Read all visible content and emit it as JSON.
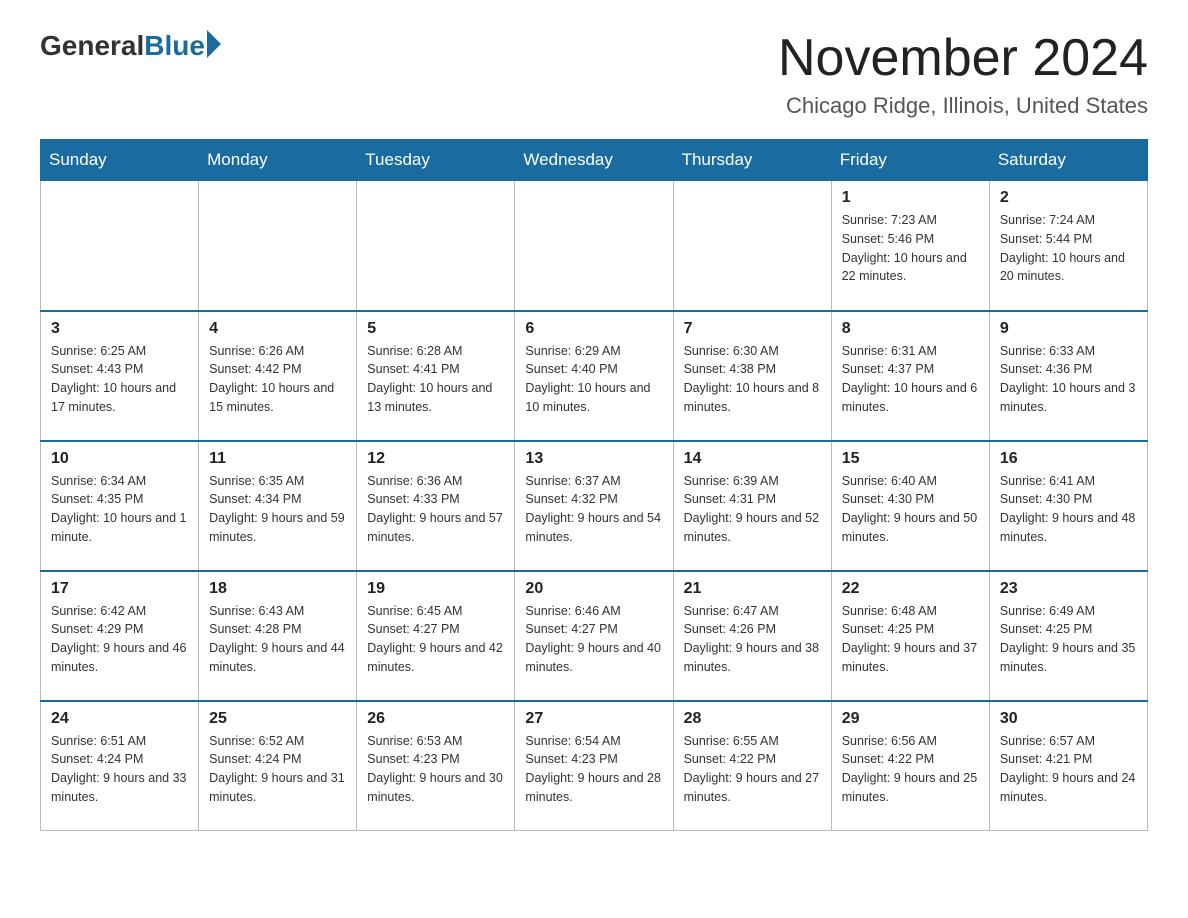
{
  "header": {
    "logo_general": "General",
    "logo_blue": "Blue",
    "month_title": "November 2024",
    "location": "Chicago Ridge, Illinois, United States"
  },
  "days_of_week": [
    "Sunday",
    "Monday",
    "Tuesday",
    "Wednesday",
    "Thursday",
    "Friday",
    "Saturday"
  ],
  "weeks": [
    [
      {
        "day": "",
        "sunrise": "",
        "sunset": "",
        "daylight": ""
      },
      {
        "day": "",
        "sunrise": "",
        "sunset": "",
        "daylight": ""
      },
      {
        "day": "",
        "sunrise": "",
        "sunset": "",
        "daylight": ""
      },
      {
        "day": "",
        "sunrise": "",
        "sunset": "",
        "daylight": ""
      },
      {
        "day": "",
        "sunrise": "",
        "sunset": "",
        "daylight": ""
      },
      {
        "day": "1",
        "sunrise": "Sunrise: 7:23 AM",
        "sunset": "Sunset: 5:46 PM",
        "daylight": "Daylight: 10 hours and 22 minutes."
      },
      {
        "day": "2",
        "sunrise": "Sunrise: 7:24 AM",
        "sunset": "Sunset: 5:44 PM",
        "daylight": "Daylight: 10 hours and 20 minutes."
      }
    ],
    [
      {
        "day": "3",
        "sunrise": "Sunrise: 6:25 AM",
        "sunset": "Sunset: 4:43 PM",
        "daylight": "Daylight: 10 hours and 17 minutes."
      },
      {
        "day": "4",
        "sunrise": "Sunrise: 6:26 AM",
        "sunset": "Sunset: 4:42 PM",
        "daylight": "Daylight: 10 hours and 15 minutes."
      },
      {
        "day": "5",
        "sunrise": "Sunrise: 6:28 AM",
        "sunset": "Sunset: 4:41 PM",
        "daylight": "Daylight: 10 hours and 13 minutes."
      },
      {
        "day": "6",
        "sunrise": "Sunrise: 6:29 AM",
        "sunset": "Sunset: 4:40 PM",
        "daylight": "Daylight: 10 hours and 10 minutes."
      },
      {
        "day": "7",
        "sunrise": "Sunrise: 6:30 AM",
        "sunset": "Sunset: 4:38 PM",
        "daylight": "Daylight: 10 hours and 8 minutes."
      },
      {
        "day": "8",
        "sunrise": "Sunrise: 6:31 AM",
        "sunset": "Sunset: 4:37 PM",
        "daylight": "Daylight: 10 hours and 6 minutes."
      },
      {
        "day": "9",
        "sunrise": "Sunrise: 6:33 AM",
        "sunset": "Sunset: 4:36 PM",
        "daylight": "Daylight: 10 hours and 3 minutes."
      }
    ],
    [
      {
        "day": "10",
        "sunrise": "Sunrise: 6:34 AM",
        "sunset": "Sunset: 4:35 PM",
        "daylight": "Daylight: 10 hours and 1 minute."
      },
      {
        "day": "11",
        "sunrise": "Sunrise: 6:35 AM",
        "sunset": "Sunset: 4:34 PM",
        "daylight": "Daylight: 9 hours and 59 minutes."
      },
      {
        "day": "12",
        "sunrise": "Sunrise: 6:36 AM",
        "sunset": "Sunset: 4:33 PM",
        "daylight": "Daylight: 9 hours and 57 minutes."
      },
      {
        "day": "13",
        "sunrise": "Sunrise: 6:37 AM",
        "sunset": "Sunset: 4:32 PM",
        "daylight": "Daylight: 9 hours and 54 minutes."
      },
      {
        "day": "14",
        "sunrise": "Sunrise: 6:39 AM",
        "sunset": "Sunset: 4:31 PM",
        "daylight": "Daylight: 9 hours and 52 minutes."
      },
      {
        "day": "15",
        "sunrise": "Sunrise: 6:40 AM",
        "sunset": "Sunset: 4:30 PM",
        "daylight": "Daylight: 9 hours and 50 minutes."
      },
      {
        "day": "16",
        "sunrise": "Sunrise: 6:41 AM",
        "sunset": "Sunset: 4:30 PM",
        "daylight": "Daylight: 9 hours and 48 minutes."
      }
    ],
    [
      {
        "day": "17",
        "sunrise": "Sunrise: 6:42 AM",
        "sunset": "Sunset: 4:29 PM",
        "daylight": "Daylight: 9 hours and 46 minutes."
      },
      {
        "day": "18",
        "sunrise": "Sunrise: 6:43 AM",
        "sunset": "Sunset: 4:28 PM",
        "daylight": "Daylight: 9 hours and 44 minutes."
      },
      {
        "day": "19",
        "sunrise": "Sunrise: 6:45 AM",
        "sunset": "Sunset: 4:27 PM",
        "daylight": "Daylight: 9 hours and 42 minutes."
      },
      {
        "day": "20",
        "sunrise": "Sunrise: 6:46 AM",
        "sunset": "Sunset: 4:27 PM",
        "daylight": "Daylight: 9 hours and 40 minutes."
      },
      {
        "day": "21",
        "sunrise": "Sunrise: 6:47 AM",
        "sunset": "Sunset: 4:26 PM",
        "daylight": "Daylight: 9 hours and 38 minutes."
      },
      {
        "day": "22",
        "sunrise": "Sunrise: 6:48 AM",
        "sunset": "Sunset: 4:25 PM",
        "daylight": "Daylight: 9 hours and 37 minutes."
      },
      {
        "day": "23",
        "sunrise": "Sunrise: 6:49 AM",
        "sunset": "Sunset: 4:25 PM",
        "daylight": "Daylight: 9 hours and 35 minutes."
      }
    ],
    [
      {
        "day": "24",
        "sunrise": "Sunrise: 6:51 AM",
        "sunset": "Sunset: 4:24 PM",
        "daylight": "Daylight: 9 hours and 33 minutes."
      },
      {
        "day": "25",
        "sunrise": "Sunrise: 6:52 AM",
        "sunset": "Sunset: 4:24 PM",
        "daylight": "Daylight: 9 hours and 31 minutes."
      },
      {
        "day": "26",
        "sunrise": "Sunrise: 6:53 AM",
        "sunset": "Sunset: 4:23 PM",
        "daylight": "Daylight: 9 hours and 30 minutes."
      },
      {
        "day": "27",
        "sunrise": "Sunrise: 6:54 AM",
        "sunset": "Sunset: 4:23 PM",
        "daylight": "Daylight: 9 hours and 28 minutes."
      },
      {
        "day": "28",
        "sunrise": "Sunrise: 6:55 AM",
        "sunset": "Sunset: 4:22 PM",
        "daylight": "Daylight: 9 hours and 27 minutes."
      },
      {
        "day": "29",
        "sunrise": "Sunrise: 6:56 AM",
        "sunset": "Sunset: 4:22 PM",
        "daylight": "Daylight: 9 hours and 25 minutes."
      },
      {
        "day": "30",
        "sunrise": "Sunrise: 6:57 AM",
        "sunset": "Sunset: 4:21 PM",
        "daylight": "Daylight: 9 hours and 24 minutes."
      }
    ]
  ]
}
